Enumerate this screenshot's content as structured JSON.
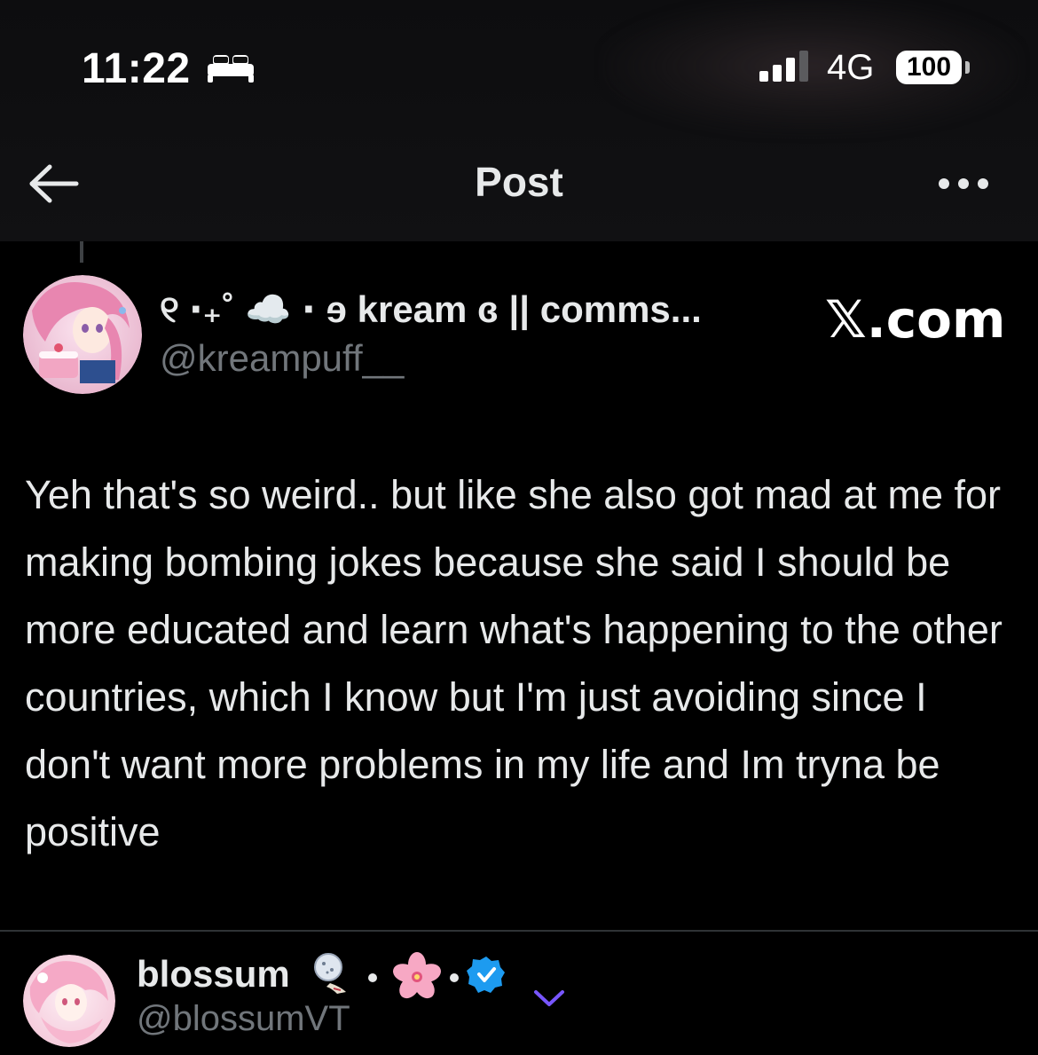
{
  "status_bar": {
    "time": "11:22",
    "network": "4G",
    "battery": "100"
  },
  "nav": {
    "title": "Post",
    "back_icon": "arrow-left-icon",
    "more_icon": "ellipsis-icon"
  },
  "quoted_post": {
    "author_name": "୧ ‧₊˚ ☁️ ⋅ ɘ kream ɞ || comms...",
    "author_handle": "@kreampuff__",
    "source_label": "𝕏.com",
    "text": "Yeh that's so weird.. but like she also got mad at me for making bombing jokes because she said I should be more educated and learn what's happening to the other countries, which I know but I'm just avoiding since I don't want more problems in my life and Im tryna be positive"
  },
  "reply_author": {
    "name": "blossum",
    "handle": "@blossumVT",
    "verified_icon": "verified-badge-icon",
    "expand_icon": "chevron-down-icon"
  },
  "colors": {
    "background": "#000000",
    "topbar": "#111113",
    "text": "#e7e9ea",
    "muted": "#71767b",
    "verified": "#1d9bf0",
    "accent_chevron": "#7856ff",
    "divider": "#2f3336"
  }
}
